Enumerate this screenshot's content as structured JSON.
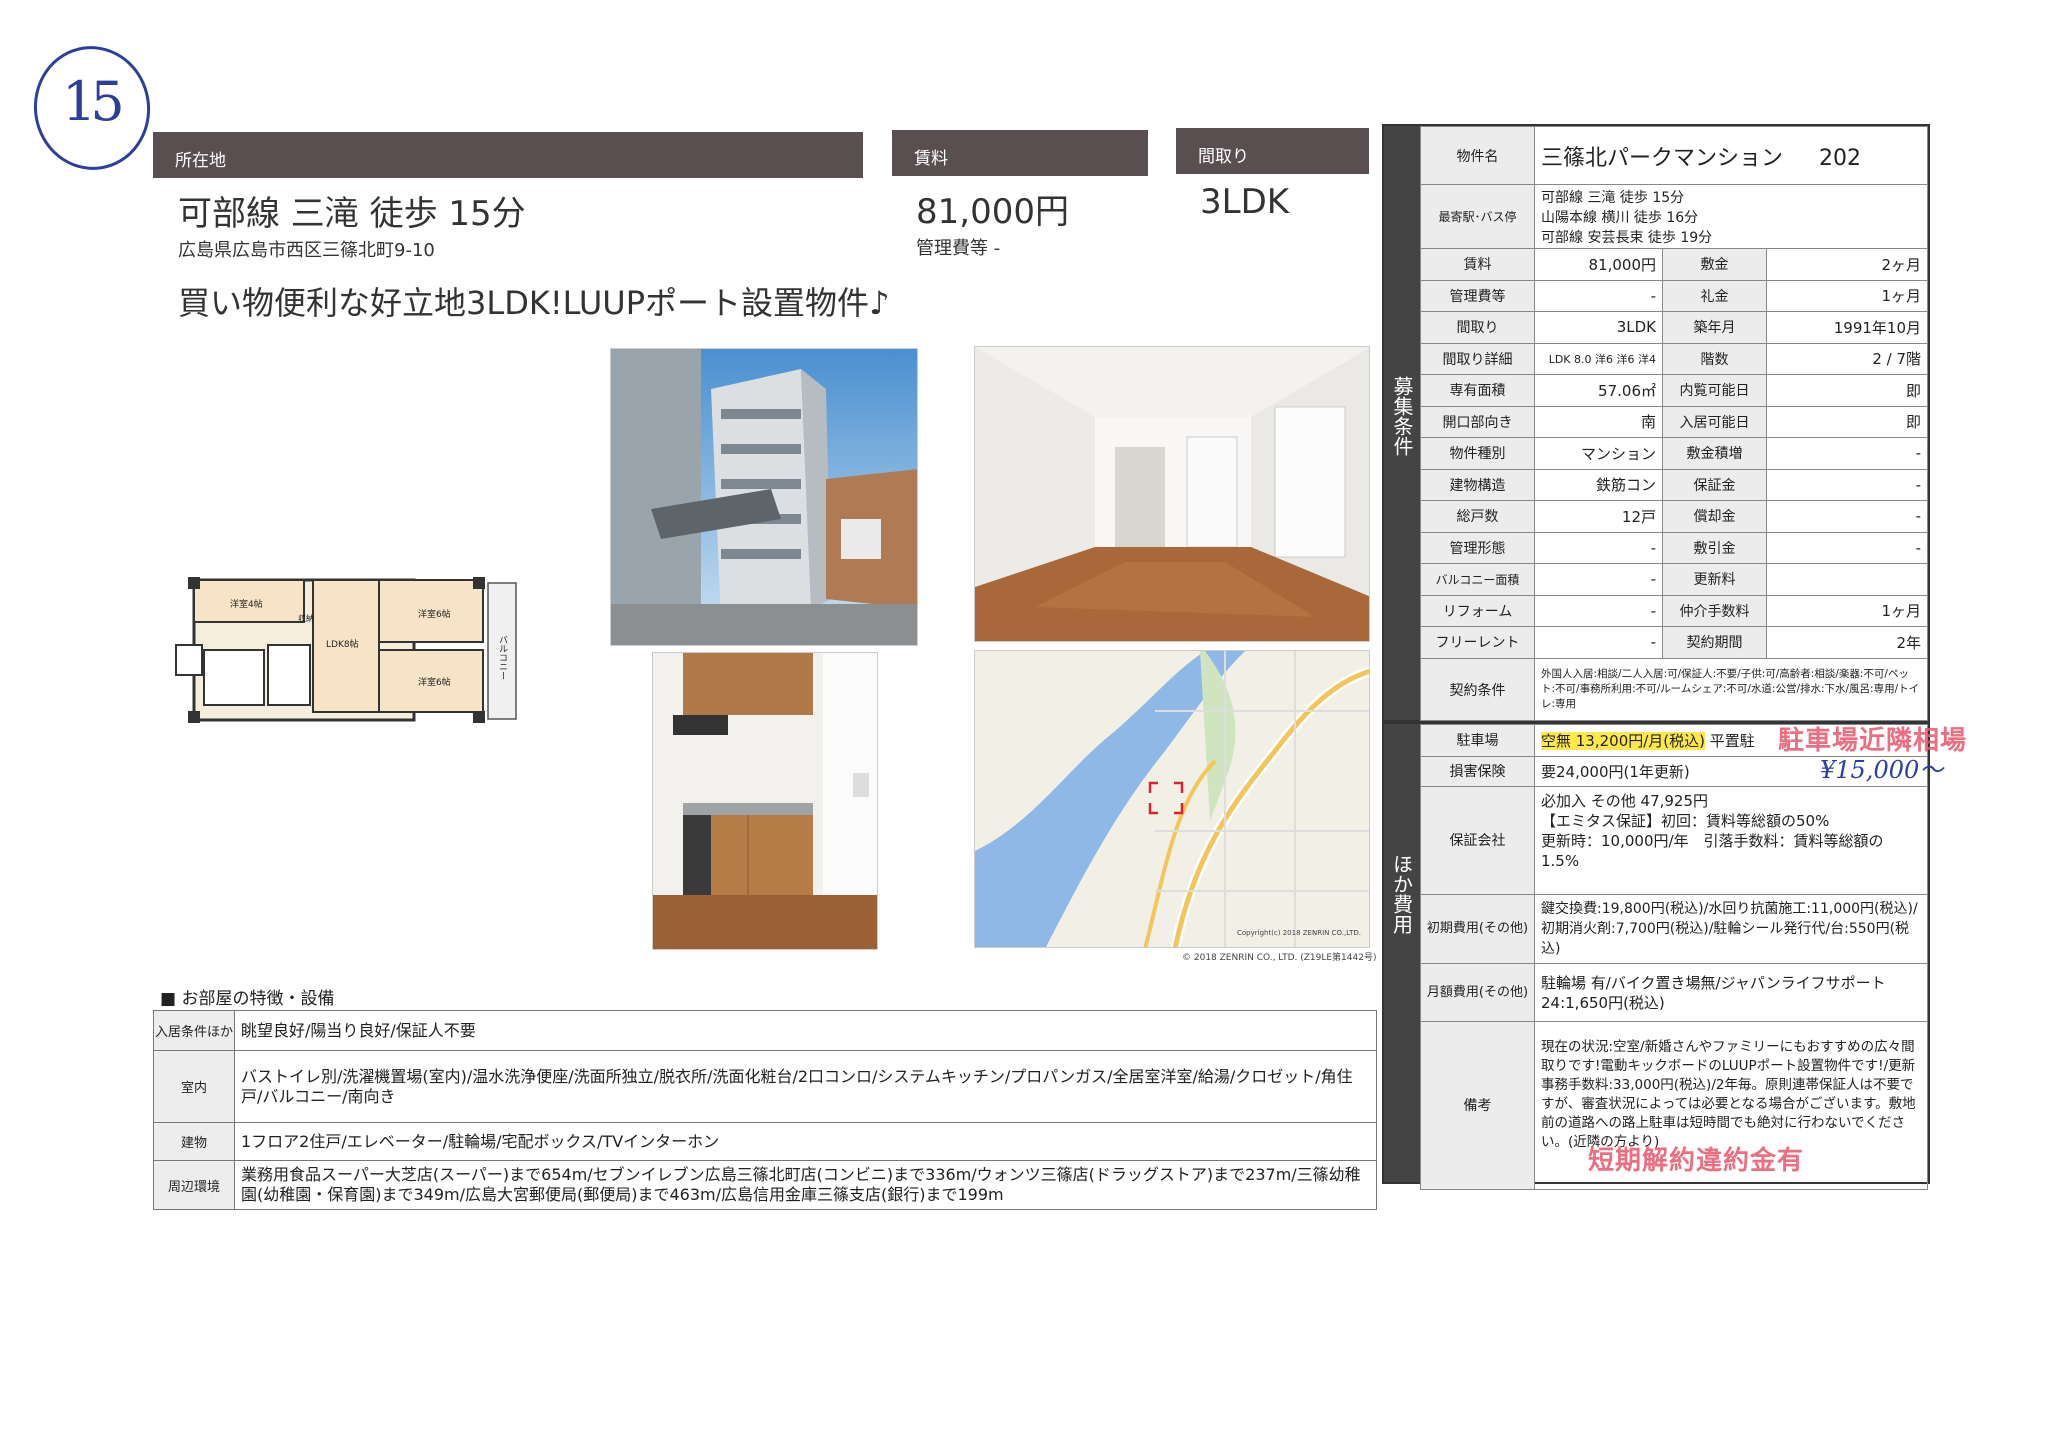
{
  "handwritten_number": "15",
  "header": {
    "location_label": "所在地",
    "rent_label": "賃料",
    "layout_label": "間取り",
    "station": "可部線 三滝 徒歩 15分",
    "address": "広島県広島市西区三篠北町9-10",
    "rent": "81,000円",
    "mgmt_fee": "管理費等 -",
    "layout": "3LDK",
    "catchphrase": "買い物便利な好立地3LDK!LUUPポート設置物件♪"
  },
  "floorplan": {
    "rooms": [
      "洋室4帖",
      "LDK8帖",
      "洋室6帖",
      "洋室6帖"
    ],
    "balcony": "バルコニー",
    "storage": "収納"
  },
  "map": {
    "copyright1": "Copyright(c) 2018 ZENRIN CO.,LTD.",
    "copyright2": "© 2018 ZENRIN CO., LTD. (Z19LE第1442号)"
  },
  "features": {
    "title": "■ お部屋の特徴・設備",
    "rows": [
      {
        "label": "入居条件ほか",
        "value": "眺望良好/陽当り良好/保証人不要"
      },
      {
        "label": "室内",
        "value": "バストイレ別/洗濯機置場(室内)/温水洗浄便座/洗面所独立/脱衣所/洗面化粧台/2口コンロ/システムキッチン/プロパンガス/全居室洋室/給湯/クロゼット/角住戸/バルコニー/南向き"
      },
      {
        "label": "建物",
        "value": "1フロア2住戸/エレベーター/駐輪場/宅配ボックス/TVインターホン"
      },
      {
        "label": "周辺環境",
        "value": "業務用食品スーパー大芝店(スーパー)まで654m/セブンイレブン広島三篠北町店(コンビニ)まで336m/ウォンツ三篠店(ドラッグストア)まで237m/三篠幼稚園(幼稚園・保育園)まで349m/広島大宮郵便局(郵便局)まで463m/広島信用金庫三篠支店(銀行)まで199m"
      }
    ]
  },
  "recruit": {
    "side_label": "募集条件",
    "property_name_label": "物件名",
    "property_name": "三篠北パークマンション",
    "room_no": "202",
    "station_label": "最寄駅･バス停",
    "stations": [
      "可部線 三滝 徒歩 15分",
      "山陽本線 横川 徒歩 16分",
      "可部線 安芸長束 徒歩 19分"
    ],
    "rows": [
      [
        "賃料",
        "81,000円",
        "敷金",
        "2ヶ月"
      ],
      [
        "管理費等",
        "-",
        "礼金",
        "1ヶ月"
      ],
      [
        "間取り",
        "3LDK",
        "築年月",
        "1991年10月"
      ],
      [
        "間取り詳細",
        "LDK 8.0 洋6 洋6 洋4",
        "階数",
        "2 / 7階"
      ],
      [
        "専有面積",
        "57.06㎡",
        "内覧可能日",
        "即"
      ],
      [
        "開口部向き",
        "南",
        "入居可能日",
        "即"
      ],
      [
        "物件種別",
        "マンション",
        "敷金積増",
        "-"
      ],
      [
        "建物構造",
        "鉄筋コン",
        "保証金",
        "-"
      ],
      [
        "総戸数",
        "12戸",
        "償却金",
        "-"
      ],
      [
        "管理形態",
        "-",
        "敷引金",
        "-"
      ],
      [
        "バルコニー面積",
        "-",
        "更新料",
        ""
      ],
      [
        "リフォーム",
        "-",
        "仲介手数料",
        "1ヶ月"
      ],
      [
        "フリーレント",
        "-",
        "契約期間",
        "2年"
      ]
    ],
    "contract_label": "契約条件",
    "contract_text": "外国人入居:相談/二人入居:可/保証人:不要/子供:可/高齢者:相談/楽器:不可/ペット:不可/事務所利用:不可/ルームシェア:不可/水道:公営/排水:下水/風呂:専用/トイレ:専用"
  },
  "other": {
    "side_label": "ほか費用",
    "parking_label": "駐車場",
    "parking_highlight": "空無 13,200円/月(税込)",
    "parking_rest": " 平置駐",
    "parking_stamp": "駐車場近隣相場",
    "parking_hand": "¥15,000〜",
    "insurance_label": "損害保険",
    "insurance": "要24,000円(1年更新)",
    "guarantee_label": "保証会社",
    "guarantee_lines": [
      "必加入 その他 47,925円",
      "【エミタス保証】初回：賃料等総額の50%",
      "更新時：10,000円/年　引落手数料：賃料等総額の1.5%"
    ],
    "initial_label": "初期費用(その他)",
    "initial": "鍵交換費:19,800円(税込)/水回り抗菌施工:11,000円(税込)/初期消火剤:7,700円(税込)/駐輪シール発行代/台:550円(税込)",
    "monthly_label": "月額費用(その他)",
    "monthly": "駐輪場 有/バイク置き場無/ジャパンライフサポート24:1,650円(税込)",
    "remarks_label": "備考",
    "remarks": "現在の状況:空室/新婚さんやファミリーにもおすすめの広々間取りです!電動キックボードのLUUPポート設置物件です!/更新事務手数料:33,000円(税込)/2年毎。原則連帯保証人は不要ですが、審査状況によっては必要となる場合がございます。敷地前の道路への路上駐車は短時間でも絶対に行わないでください。(近隣の方より)",
    "remarks_stamp": "短期解約違約金有"
  },
  "colors": {
    "header_bar": "#5a4f50",
    "highlight": "#ffe94a",
    "stamp_red": "#e8576b",
    "ink_blue": "#2d3f9a"
  }
}
